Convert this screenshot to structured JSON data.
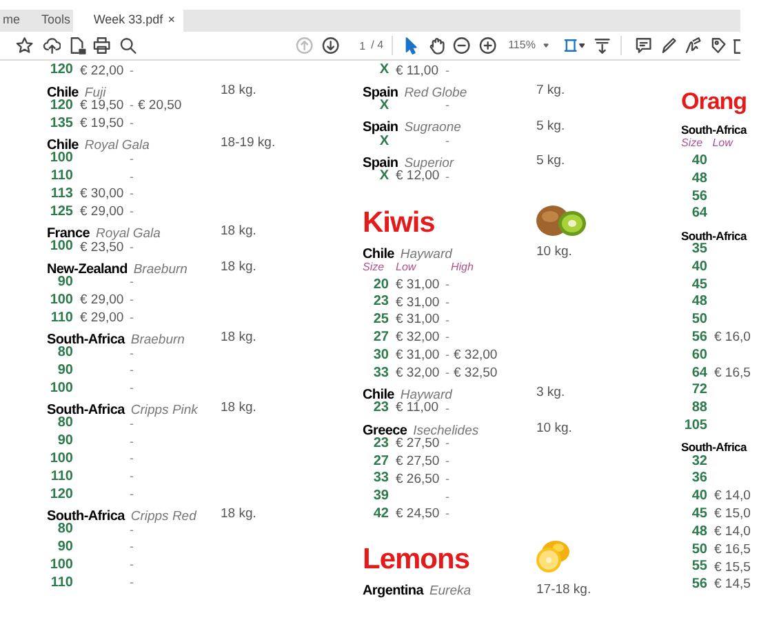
{
  "tabs": [
    {
      "label": "me",
      "selected": false
    },
    {
      "label": "Tools",
      "selected": false
    },
    {
      "label": "Week 33.pdf",
      "selected": true,
      "close": "×"
    }
  ],
  "toolbar": {
    "prev_page": {
      "disabled": true
    },
    "next_page": {
      "disabled": false
    },
    "page": "1",
    "page_count": "/ 4",
    "select_tool": {
      "selected": true
    },
    "hand_tool": {
      "selected": false
    },
    "zoom": "115%"
  },
  "columns": [
    {
      "items": [
        {
          "kind": "size",
          "size": "120",
          "low": "€ 22,00",
          "dash": "-"
        },
        {
          "kind": "product",
          "origin": "Chile",
          "variety": "Fuji",
          "weight": "18 kg."
        },
        {
          "kind": "size",
          "size": "120",
          "low": "€ 19,50",
          "dash": "-",
          "high": "€ 20,50"
        },
        {
          "kind": "size",
          "size": "135",
          "low": "€ 19,50",
          "dash": "-"
        },
        {
          "kind": "product",
          "origin": "Chile",
          "variety": "Royal Gala",
          "weight": "18-19 kg."
        },
        {
          "kind": "size",
          "size": "100",
          "dash": "-"
        },
        {
          "kind": "size",
          "size": "110",
          "dash": "-"
        },
        {
          "kind": "size",
          "size": "113",
          "low": "€ 30,00",
          "dash": "-"
        },
        {
          "kind": "size",
          "size": "125",
          "low": "€ 29,00",
          "dash": "-"
        },
        {
          "kind": "product",
          "origin": "France",
          "variety": "Royal Gala",
          "weight": "18 kg."
        },
        {
          "kind": "size",
          "size": "100",
          "low": "€ 23,50",
          "dash": "-"
        },
        {
          "kind": "product",
          "origin": "New-Zealand",
          "variety": "Braeburn",
          "weight": "18 kg."
        },
        {
          "kind": "size",
          "size": "90",
          "dash": "-"
        },
        {
          "kind": "size",
          "size": "100",
          "low": "€ 29,00",
          "dash": "-"
        },
        {
          "kind": "size",
          "size": "110",
          "low": "€ 29,00",
          "dash": "-"
        },
        {
          "kind": "product",
          "origin": "South-Africa",
          "variety": "Braeburn",
          "weight": "18 kg."
        },
        {
          "kind": "size",
          "size": "80",
          "dash": "-"
        },
        {
          "kind": "size",
          "size": "90",
          "dash": "-"
        },
        {
          "kind": "size",
          "size": "100",
          "dash": "-"
        },
        {
          "kind": "product",
          "origin": "South-Africa",
          "variety": "Cripps Pink",
          "weight": "18 kg."
        },
        {
          "kind": "size",
          "size": "80",
          "dash": "-"
        },
        {
          "kind": "size",
          "size": "90",
          "dash": "-"
        },
        {
          "kind": "size",
          "size": "100",
          "dash": "-"
        },
        {
          "kind": "size",
          "size": "110",
          "dash": "-"
        },
        {
          "kind": "size",
          "size": "120",
          "dash": "-"
        },
        {
          "kind": "product",
          "origin": "South-Africa",
          "variety": "Cripps Red",
          "weight": "18 kg."
        },
        {
          "kind": "size",
          "size": "80",
          "dash": "-"
        },
        {
          "kind": "size",
          "size": "90",
          "dash": "-"
        },
        {
          "kind": "size",
          "size": "100",
          "dash": "-"
        },
        {
          "kind": "size",
          "size": "110",
          "dash": "-"
        }
      ]
    },
    {
      "items": [
        {
          "kind": "size",
          "size": "X",
          "low": "€ 11,00",
          "dash": "-"
        },
        {
          "kind": "product",
          "origin": "Spain",
          "variety": "Red Globe",
          "weight": "7 kg."
        },
        {
          "kind": "size",
          "size": "X",
          "dash": "-"
        },
        {
          "kind": "product",
          "origin": "Spain",
          "variety": "Sugraone",
          "weight": "5 kg."
        },
        {
          "kind": "size",
          "size": "X",
          "dash": "-"
        },
        {
          "kind": "product",
          "origin": "Spain",
          "variety": "Superior",
          "weight": "5 kg."
        },
        {
          "kind": "size",
          "size": "X",
          "low": "€ 12,00",
          "dash": "-"
        },
        {
          "kind": "heading",
          "text": "Kiwis",
          "picture": true
        },
        {
          "kind": "product",
          "origin": "Chile",
          "variety": "Hayward",
          "weight": "10 kg."
        },
        {
          "kind": "labels",
          "size": "Size",
          "low": "Low",
          "high": "High"
        },
        {
          "kind": "size",
          "size": "20",
          "low": "€ 31,00",
          "dash": "-"
        },
        {
          "kind": "size",
          "size": "23",
          "low": "€ 31,00",
          "dash": "-"
        },
        {
          "kind": "size",
          "size": "25",
          "low": "€ 31,00",
          "dash": "-"
        },
        {
          "kind": "size",
          "size": "27",
          "low": "€ 32,00",
          "dash": "-"
        },
        {
          "kind": "size",
          "size": "30",
          "low": "€ 31,00",
          "dash": "-",
          "high": "€ 32,00"
        },
        {
          "kind": "size",
          "size": "33",
          "low": "€ 32,00",
          "dash": "-",
          "high": "€ 32,50"
        },
        {
          "kind": "product",
          "origin": "Chile",
          "variety": "Hayward",
          "weight": "3 kg."
        },
        {
          "kind": "size",
          "size": "23",
          "low": "€ 11,00",
          "dash": "-"
        },
        {
          "kind": "product",
          "origin": "Greece",
          "variety": "Isechelides",
          "weight": "10 kg."
        },
        {
          "kind": "size",
          "size": "23",
          "low": "€ 27,50",
          "dash": "-"
        },
        {
          "kind": "size",
          "size": "27",
          "low": "€ 27,50",
          "dash": "-"
        },
        {
          "kind": "size",
          "size": "33",
          "low": "€ 26,50",
          "dash": "-"
        },
        {
          "kind": "size",
          "size": "39",
          "dash": "-"
        },
        {
          "kind": "size",
          "size": "42",
          "low": "€ 24,50",
          "dash": "-"
        },
        {
          "kind": "heading",
          "text": "Lemons",
          "picture": true
        },
        {
          "kind": "product",
          "origin": "Argentina",
          "variety": "Eureka",
          "weight": "17-18 kg."
        }
      ]
    },
    {
      "items": [
        {
          "kind": "heading",
          "text": "Orang"
        },
        {
          "kind": "product",
          "origin": "South-Africa"
        },
        {
          "kind": "labels",
          "size": "Size",
          "low": "Low"
        },
        {
          "kind": "size",
          "size": "40"
        },
        {
          "kind": "size",
          "size": "48"
        },
        {
          "kind": "size",
          "size": "56"
        },
        {
          "kind": "size",
          "size": "64"
        },
        {
          "kind": "product",
          "origin": "South-Africa"
        },
        {
          "kind": "size",
          "size": "35"
        },
        {
          "kind": "size",
          "size": "40"
        },
        {
          "kind": "size",
          "size": "45"
        },
        {
          "kind": "size",
          "size": "48"
        },
        {
          "kind": "size",
          "size": "50"
        },
        {
          "kind": "size",
          "size": "56",
          "low": "€ 16,0"
        },
        {
          "kind": "size",
          "size": "60"
        },
        {
          "kind": "size",
          "size": "64",
          "low": "€ 16,5"
        },
        {
          "kind": "size",
          "size": "72"
        },
        {
          "kind": "size",
          "size": "88"
        },
        {
          "kind": "size",
          "size": "105"
        },
        {
          "kind": "product",
          "origin": "South-Africa"
        },
        {
          "kind": "size",
          "size": "32"
        },
        {
          "kind": "size",
          "size": "36"
        },
        {
          "kind": "size",
          "size": "40",
          "low": "€ 14,0"
        },
        {
          "kind": "size",
          "size": "45",
          "low": "€ 15,0"
        },
        {
          "kind": "size",
          "size": "48",
          "low": "€ 14,0"
        },
        {
          "kind": "size",
          "size": "50",
          "low": "€ 16,5"
        },
        {
          "kind": "size",
          "size": "55",
          "low": "€ 15,5"
        },
        {
          "kind": "size",
          "size": "56",
          "low": "€ 14,5"
        }
      ]
    }
  ]
}
